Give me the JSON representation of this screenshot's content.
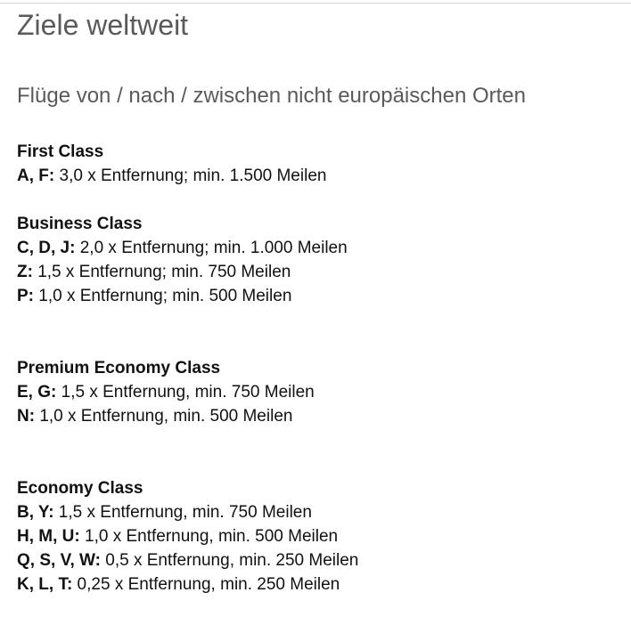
{
  "page": {
    "title": "Ziele weltweit",
    "section_title": "Flüge von / nach / zwischen nicht europäischen Orten"
  },
  "classes": [
    {
      "name": "First Class",
      "rates": [
        {
          "codes": "A, F:",
          "text": " 3,0 x Entfernung; min. 1.500 Meilen"
        }
      ]
    },
    {
      "name": "Business Class",
      "rates": [
        {
          "codes": "C, D, J:",
          "text": " 2,0 x Entfernung; min. 1.000 Meilen"
        },
        {
          "codes": "Z:",
          "text": " 1,5 x Entfernung; min. 750 Meilen"
        },
        {
          "codes": "P:",
          "text": " 1,0 x Entfernung; min. 500 Meilen"
        }
      ]
    },
    {
      "name": "Premium Economy Class",
      "rates": [
        {
          "codes": "E, G:",
          "text": " 1,5 x Entfernung, min. 750 Meilen"
        },
        {
          "codes": "N:",
          "text": " 1,0 x Entfernung, min. 500 Meilen"
        }
      ]
    },
    {
      "name": "Economy Class",
      "rates": [
        {
          "codes": "B, Y:",
          "text": " 1,5 x Entfernung, min. 750 Meilen"
        },
        {
          "codes": "H, M, U:",
          "text": " 1,0 x Entfernung, min. 500 Meilen"
        },
        {
          "codes": "Q, S, V, W:",
          "text": " 0,5 x Entfernung, min. 250 Meilen"
        },
        {
          "codes": "K, L, T:",
          "text": " 0,25 x Entfernung, min. 250 Meilen"
        }
      ]
    }
  ]
}
